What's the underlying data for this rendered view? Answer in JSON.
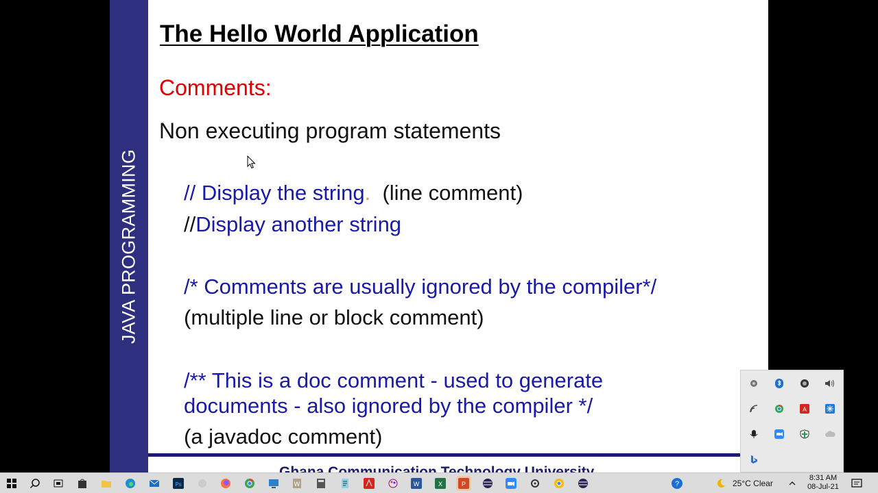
{
  "slide": {
    "sidebar_label": "JAVA PROGRAMMING",
    "title": "The Hello World Application",
    "heading": "Comments:",
    "subheading": "Non executing program statements",
    "line1_blue": "// Display the string",
    "line1_dot": ".",
    "line1_black": "(line comment)",
    "line2_black": "//",
    "line2_blue": "Display another string",
    "line3_blue": "/* Comments are usually ignored by the compiler*/",
    "line4_black": "(multiple line or block comment)",
    "line5_blue": "/** This is a doc comment - used to generate",
    "line6_blue": "documents - also ignored by the compiler */",
    "line7_black": "(a javadoc comment)",
    "footer": "Ghana Communication Technology University",
    "colors": {
      "sidebar": "#2f2f7f",
      "heading": "#e00000",
      "code": "#1a1aa8",
      "rule": "#1c1c6e"
    }
  },
  "tray_flyout": {
    "icons": [
      "screen-record-icon",
      "bluetooth-icon",
      "app-icon",
      "volume-icon",
      "wifi-icon",
      "chrome-icon",
      "adobe-icon",
      "snowflake-icon",
      "microphone-icon",
      "zoom-icon",
      "shield-icon",
      "cloud-icon",
      "bing-icon"
    ]
  },
  "taskbar": {
    "weather": "25°C  Clear",
    "time": "8:31 AM",
    "date": "08-Jul-21"
  }
}
